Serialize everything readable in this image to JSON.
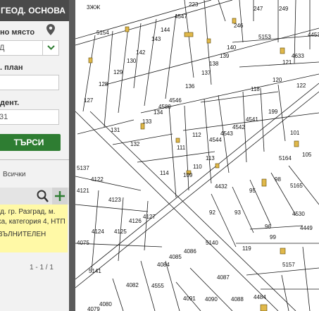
{
  "panel": {
    "title": "ГЕОД. ОСНОВА",
    "place_label": "но място",
    "place_value": "Д",
    "plan_label": ". план",
    "ident_label": "дент.",
    "ident_value": "31",
    "search_label": "ТЪРСИ",
    "all_label": "Всички",
    "result_lines": [
      "гд. гр. Разград, м.",
      "ка, категория 4, НТП",
      "ВЪЛНИТЕЛЕН"
    ],
    "pager": "1 - 1 / 1"
  },
  "map": {
    "parcel_ids": [
      "3ЖЖ",
      "223",
      "4547",
      "247",
      "249",
      "5154",
      "144",
      "246",
      "5153",
      "4633",
      "4453",
      "143",
      "140",
      "142",
      "130",
      "139",
      "121",
      "138",
      "129",
      "137",
      "128",
      "136",
      "118",
      "120",
      "122",
      "127",
      "4546",
      "4580",
      "134",
      "199",
      "4541",
      "4542",
      "133",
      "4543",
      "131",
      "112",
      "4544",
      "101",
      "132",
      "111",
      "113",
      "105",
      "110",
      "5164",
      "5137",
      "114",
      "109",
      "98",
      "4122",
      "4121",
      "4432",
      "95",
      "5165",
      "4123",
      "92",
      "93",
      "4530",
      "4127",
      "4124",
      "4125",
      "4126",
      "96",
      "4449",
      "99",
      "4075",
      "5140",
      "119",
      "4086",
      "4085",
      "4084",
      "5157",
      "5141",
      "4087",
      "4082",
      "4555",
      "4080",
      "4091",
      "4090",
      "4088",
      "4484",
      "4079"
    ]
  }
}
